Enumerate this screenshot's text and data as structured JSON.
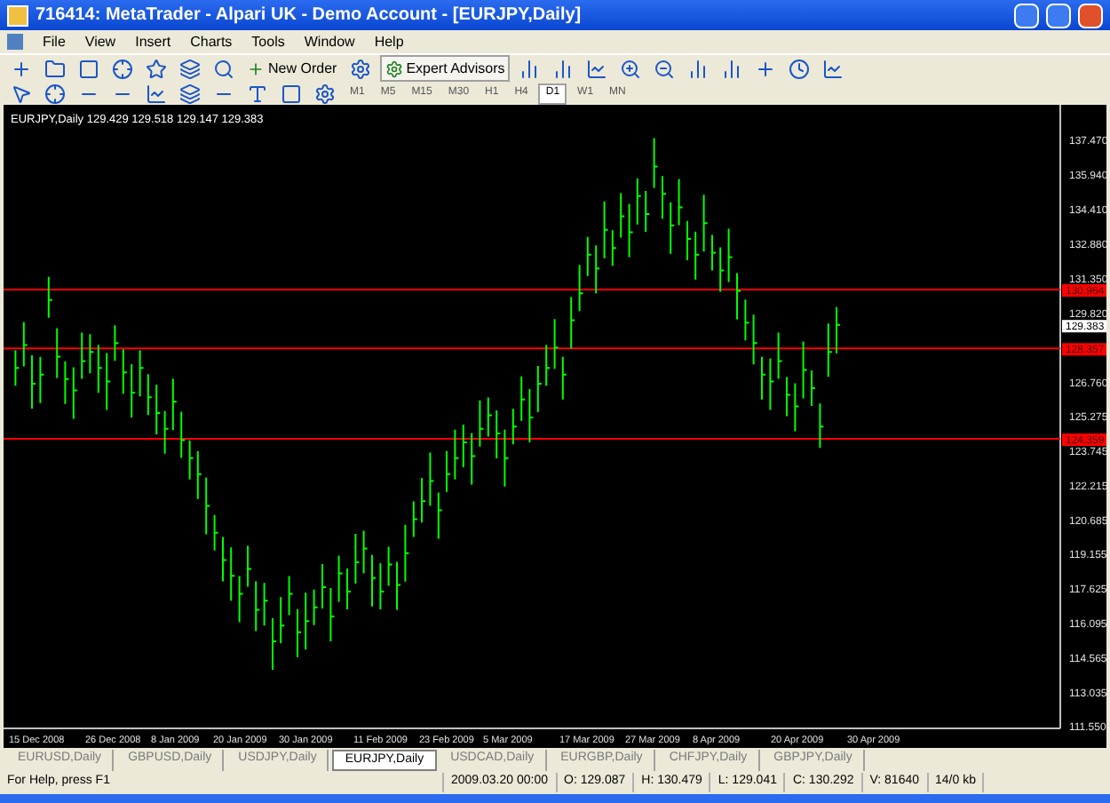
{
  "window": {
    "title": "716414: MetaTrader - Alpari UK - Demo Account - [EURJPY,Daily]"
  },
  "menu": [
    "File",
    "View",
    "Insert",
    "Charts",
    "Tools",
    "Window",
    "Help"
  ],
  "toolbar": {
    "new_order": "New Order",
    "expert_advisors": "Expert Advisors"
  },
  "timeframes": [
    {
      "label": "M1",
      "selected": false
    },
    {
      "label": "M5",
      "selected": false
    },
    {
      "label": "M15",
      "selected": false
    },
    {
      "label": "M30",
      "selected": false
    },
    {
      "label": "H1",
      "selected": false
    },
    {
      "label": "H4",
      "selected": false
    },
    {
      "label": "D1",
      "selected": true
    },
    {
      "label": "W1",
      "selected": false
    },
    {
      "label": "MN",
      "selected": false
    }
  ],
  "chart": {
    "header": "EURJPY,Daily  129.429 129.518 129.147 129.383",
    "price_scale": [
      "137.470",
      "135.940",
      "134.410",
      "132.880",
      "131.350",
      "129.820",
      "126.760",
      "125.275",
      "123.745",
      "122.215",
      "120.685",
      "119.155",
      "117.625",
      "116.095",
      "114.565",
      "113.035",
      "111.550"
    ],
    "date_scale": [
      "15 Dec 2008",
      "26 Dec 2008",
      "8 Jan 2009",
      "20 Jan 2009",
      "30 Jan 2009",
      "11 Feb 2009",
      "23 Feb 2009",
      "5 Mar 2009",
      "17 Mar 2009",
      "27 Mar 2009",
      "8 Apr 2009",
      "20 Apr 2009",
      "30 Apr 2009"
    ],
    "price_tags": [
      {
        "kind": "level",
        "label": "130.964"
      },
      {
        "kind": "current",
        "label": "129.383"
      },
      {
        "kind": "level",
        "label": "128.357"
      },
      {
        "kind": "level",
        "label": "124.359"
      }
    ]
  },
  "tabs": [
    {
      "label": "EURUSD,Daily",
      "selected": false
    },
    {
      "label": "GBPUSD,Daily",
      "selected": false
    },
    {
      "label": "USDJPY,Daily",
      "selected": false
    },
    {
      "label": "EURJPY,Daily",
      "selected": true
    },
    {
      "label": "USDCAD,Daily",
      "selected": false
    },
    {
      "label": "EURGBP,Daily",
      "selected": false
    },
    {
      "label": "CHFJPY,Daily",
      "selected": false
    },
    {
      "label": "GBPJPY,Daily",
      "selected": false
    }
  ],
  "status_bar": [
    "For Help, press F1",
    "2009.03.20 00:00",
    "O: 129.087",
    "H: 130.479",
    "L: 129.041",
    "C: 130.292",
    "V: 81640",
    "14/0 kb"
  ]
}
